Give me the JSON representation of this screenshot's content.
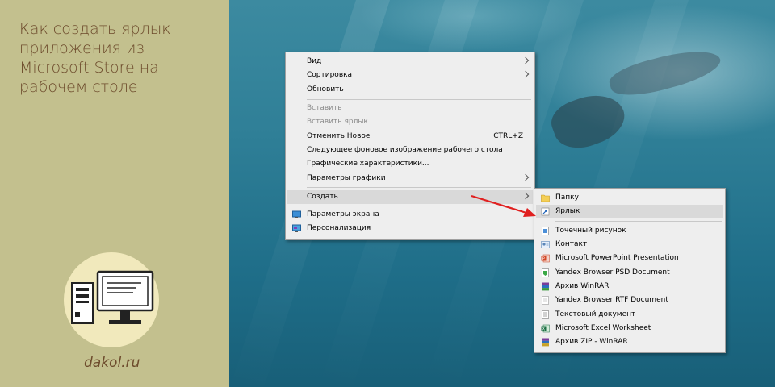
{
  "article": {
    "title_lines": [
      "Как создать ярлык",
      "приложения из",
      "Microsoft Store на",
      "рабочем столе"
    ],
    "site": "dakol.ru"
  },
  "context_menu": {
    "items": [
      {
        "label": "Вид",
        "submenu": true
      },
      {
        "label": "Сортировка",
        "submenu": true
      },
      {
        "label": "Обновить"
      },
      {
        "label": "Вставить",
        "disabled": true
      },
      {
        "label": "Вставить ярлык",
        "disabled": true
      },
      {
        "label": "Отменить Новое",
        "shortcut": "CTRL+Z"
      },
      {
        "label": "Следующее фоновое изображение рабочего стола"
      },
      {
        "label": "Графические характеристики..."
      },
      {
        "label": "Параметры графики",
        "submenu": true
      },
      {
        "label": "Создать",
        "submenu": true,
        "highlighted": true
      },
      {
        "label": "Параметры экрана",
        "icon": "display-icon"
      },
      {
        "label": "Персонализация",
        "icon": "personalize-icon"
      }
    ]
  },
  "submenu": {
    "items": [
      {
        "label": "Папку",
        "icon": "folder-icon"
      },
      {
        "label": "Ярлык",
        "icon": "shortcut-icon",
        "highlighted": true
      },
      {
        "label": "Точечный рисунок",
        "icon": "bitmap-icon"
      },
      {
        "label": "Контакт",
        "icon": "contact-icon"
      },
      {
        "label": "Microsoft PowerPoint Presentation",
        "icon": "powerpoint-icon"
      },
      {
        "label": "Yandex Browser PSD Document",
        "icon": "yandex-psd-icon"
      },
      {
        "label": "Архив WinRAR",
        "icon": "winrar-icon"
      },
      {
        "label": "Yandex Browser RTF Document",
        "icon": "yandex-rtf-icon"
      },
      {
        "label": "Текстовый документ",
        "icon": "text-document-icon"
      },
      {
        "label": "Microsoft Excel Worksheet",
        "icon": "excel-icon"
      },
      {
        "label": "Архив ZIP - WinRAR",
        "icon": "winrar-zip-icon"
      }
    ]
  },
  "colors": {
    "left_panel": "#c3c08e",
    "title_text": "#6d4b2c",
    "logo_circle": "#f1e9bc",
    "annotation_arrow": "#e02020",
    "menu_bg": "#eeeeee",
    "menu_highlight": "#d9d9d9"
  }
}
